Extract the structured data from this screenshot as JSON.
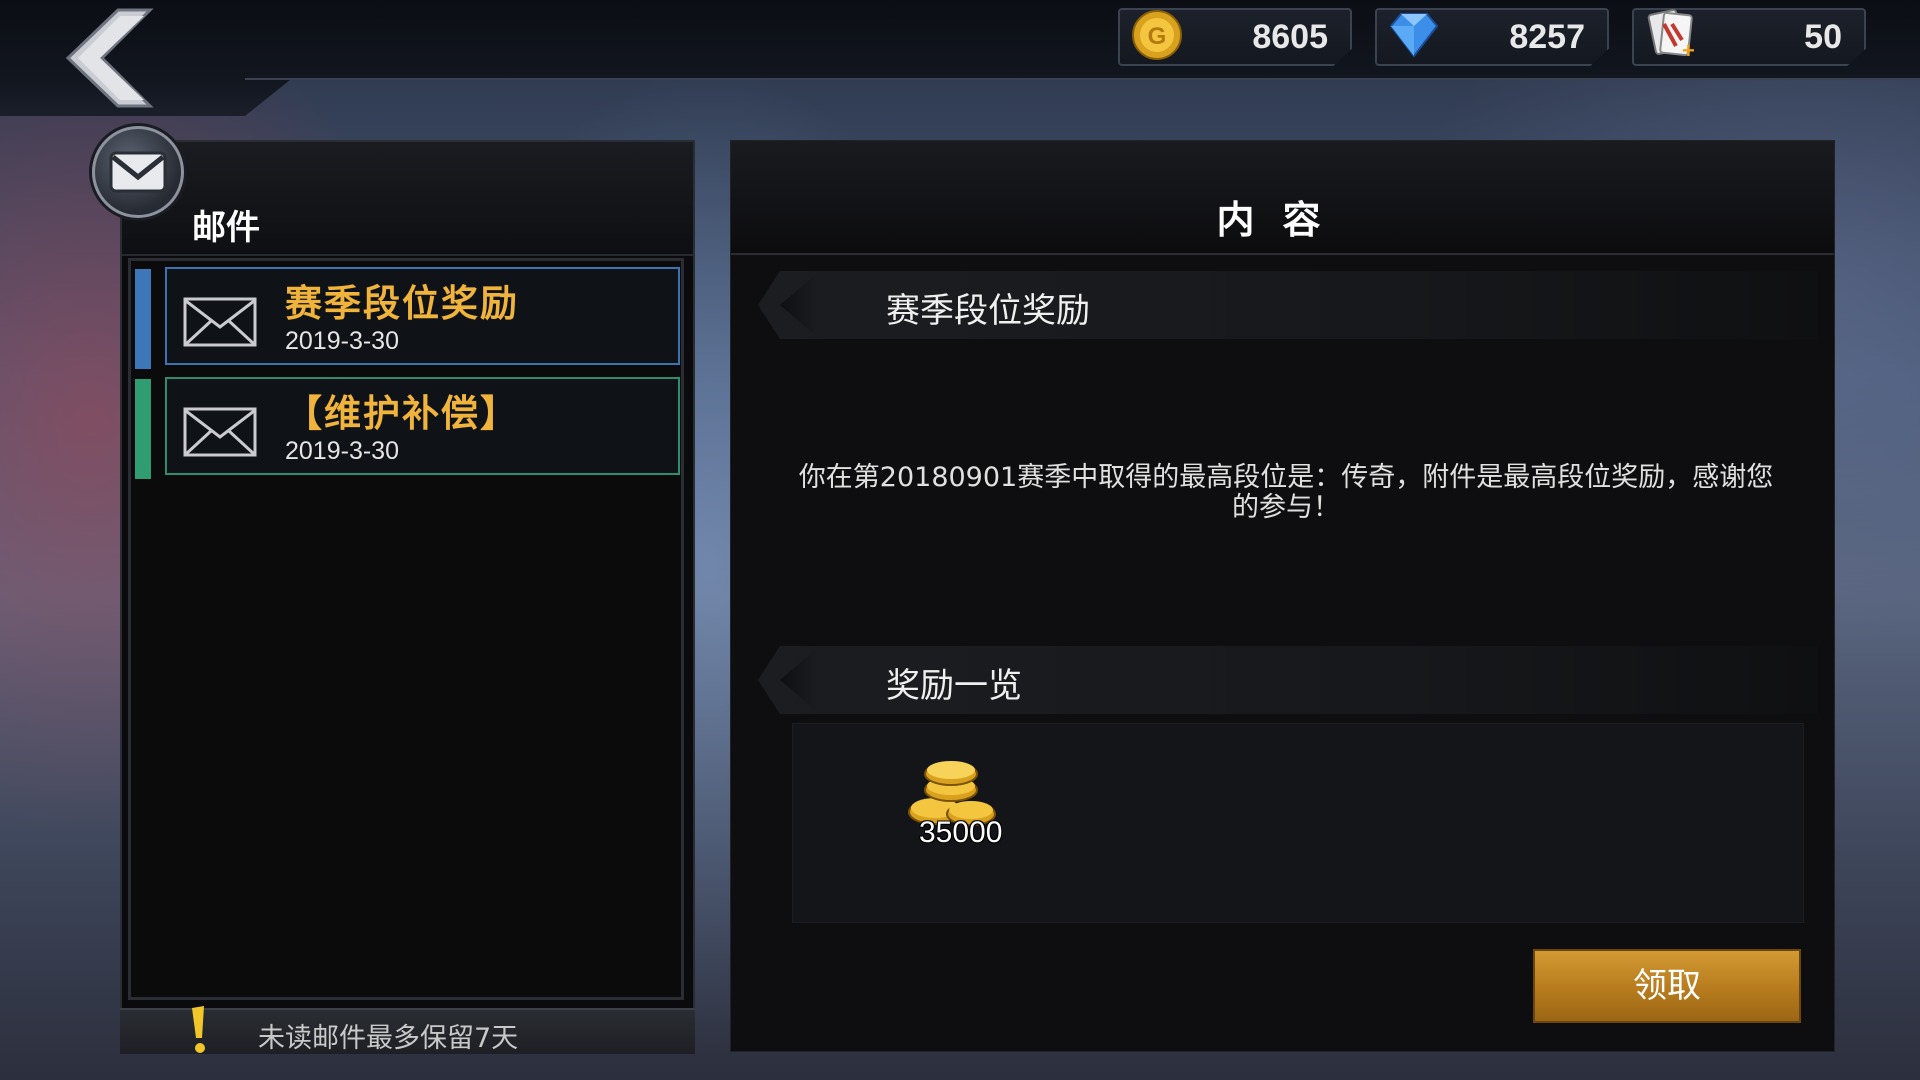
{
  "currencies": {
    "gold": {
      "value": "8605",
      "icon": "gold-coin-icon"
    },
    "diamond": {
      "value": "8257",
      "icon": "diamond-icon"
    },
    "ticket": {
      "value": "50",
      "icon": "card-ticket-icon"
    }
  },
  "mail_panel": {
    "title": "邮件",
    "items": [
      {
        "title": "赛季段位奖励",
        "date": "2019-3-30",
        "stripe_color": "#3d77b8"
      },
      {
        "title": "【维护补偿】",
        "date": "2019-3-30",
        "stripe_color": "#2f9c72"
      }
    ],
    "notice": "未读邮件最多保留7天"
  },
  "content_panel": {
    "title": "内容",
    "mail_subject": "赛季段位奖励",
    "body": "你在第20180901赛季中取得的最高段位是：传奇，附件是最高段位奖励，感谢您的参与！",
    "rewards_title": "奖励一览",
    "rewards": [
      {
        "icon": "gold-coins-icon",
        "count": "35000"
      }
    ],
    "claim_label": "领取"
  },
  "colors": {
    "accent_gold": "#f0b33c",
    "button": "#c0862a"
  }
}
